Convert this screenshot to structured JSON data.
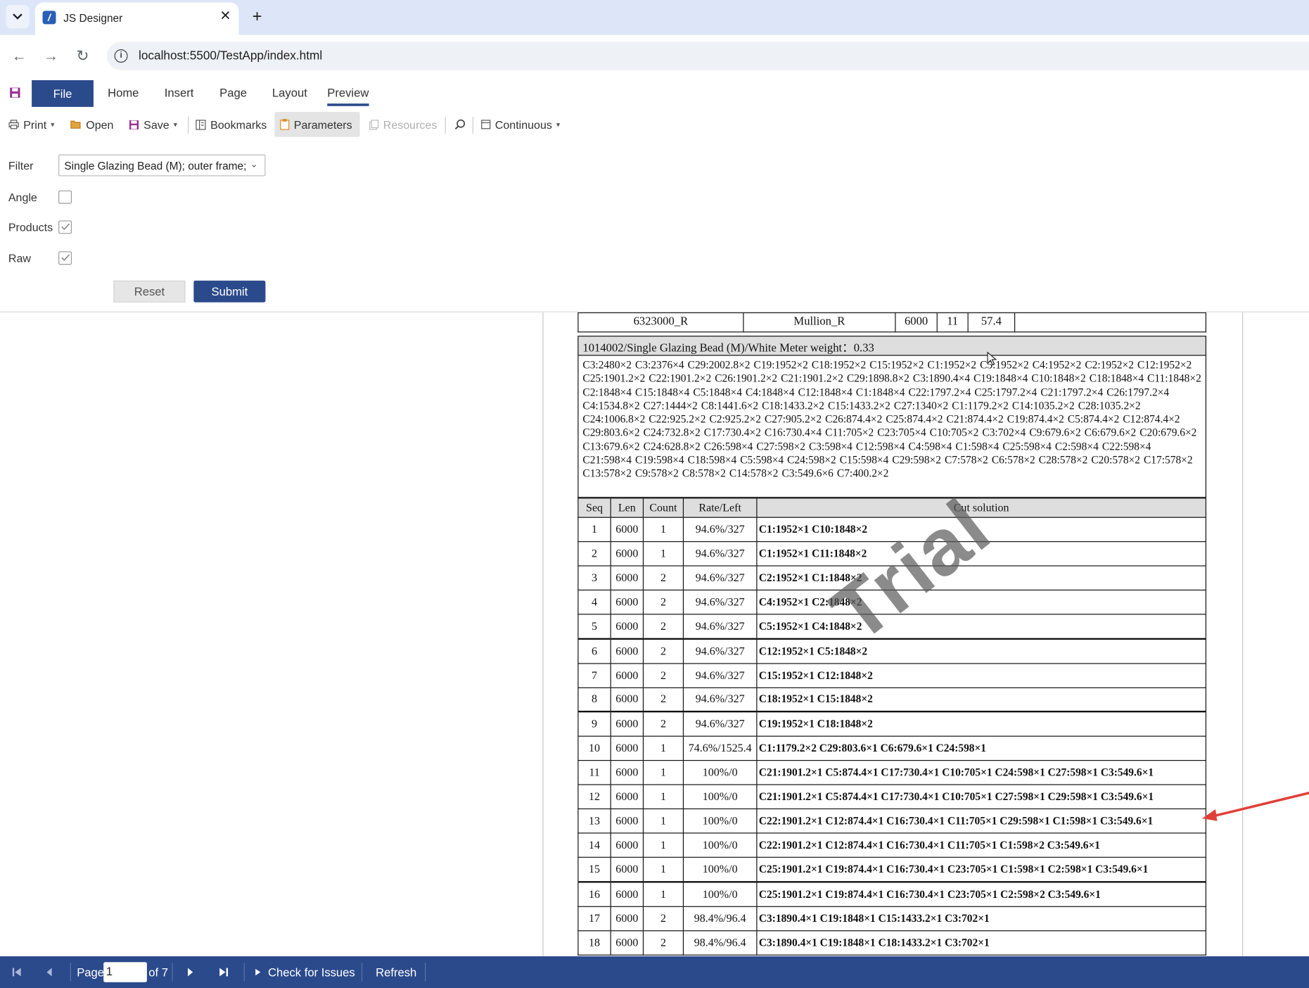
{
  "browser": {
    "tab_title": "JS Designer",
    "url": "localhost:5500/TestApp/index.html"
  },
  "ribbon": {
    "tabs": [
      "File",
      "Home",
      "Insert",
      "Page",
      "Layout",
      "Preview"
    ],
    "active_tab": "Preview"
  },
  "toolbar": {
    "print": "Print",
    "open": "Open",
    "save": "Save",
    "bookmarks": "Bookmarks",
    "parameters": "Parameters",
    "resources": "Resources",
    "continuous": "Continuous"
  },
  "parameters": {
    "filter_label": "Filter",
    "filter_value": "Single Glazing Bead (M); outer frame;",
    "angle_label": "Angle",
    "angle_checked": false,
    "products_label": "Products",
    "products_checked": true,
    "raw_label": "Raw",
    "raw_checked": true,
    "reset": "Reset",
    "submit": "Submit"
  },
  "report": {
    "top_row": [
      "6323000_R",
      "Mullion_R",
      "6000",
      "11",
      "57.4",
      ""
    ],
    "material_header": "1014002/Single Glazing Bead (M)/White Meter weight：0.33",
    "material_cuts": "C3:2480×2 C3:2376×4 C29:2002.8×2 C19:1952×2 C18:1952×2 C15:1952×2 C1:1952×2 C5:1952×2 C4:1952×2 C2:1952×2 C12:1952×2 C25:1901.2×2 C22:1901.2×2 C26:1901.2×2 C21:1901.2×2 C29:1898.8×2 C3:1890.4×4 C19:1848×4 C10:1848×2 C18:1848×4 C11:1848×2 C2:1848×4 C15:1848×4 C5:1848×4 C4:1848×4 C12:1848×4 C1:1848×4 C22:1797.2×4 C25:1797.2×4 C21:1797.2×4 C26:1797.2×4 C4:1534.8×2 C27:1444×2 C8:1441.6×2 C18:1433.2×2 C15:1433.2×2 C27:1340×2 C1:1179.2×2 C14:1035.2×2 C28:1035.2×2 C24:1006.8×2 C22:925.2×2 C2:925.2×2 C27:905.2×2 C26:874.4×2 C25:874.4×2 C21:874.4×2 C19:874.4×2 C5:874.4×2 C12:874.4×2 C29:803.6×2 C24:732.8×2 C17:730.4×2 C16:730.4×4 C11:705×2 C23:705×4 C10:705×2 C3:702×4 C9:679.6×2 C6:679.6×2 C20:679.6×2 C13:679.6×2 C24:628.8×2 C26:598×4 C27:598×2 C3:598×4 C12:598×4 C4:598×4 C1:598×4 C25:598×4 C2:598×4 C22:598×4 C21:598×4 C19:598×4 C18:598×4 C5:598×4 C24:598×2 C15:598×4 C29:598×2 C7:578×2 C6:578×2 C28:578×2 C20:578×2 C17:578×2 C13:578×2 C9:578×2 C8:578×2 C14:578×2 C3:549.6×6 C7:400.2×2",
    "columns": [
      "Seq",
      "Len",
      "Count",
      "Rate/Left",
      "Cut solution"
    ],
    "rows": [
      [
        "1",
        "6000",
        "1",
        "94.6%/327",
        "C1:1952×1  C10:1848×2"
      ],
      [
        "2",
        "6000",
        "1",
        "94.6%/327",
        "C1:1952×1  C11:1848×2"
      ],
      [
        "3",
        "6000",
        "2",
        "94.6%/327",
        "C2:1952×1  C1:1848×2"
      ],
      [
        "4",
        "6000",
        "2",
        "94.6%/327",
        "C4:1952×1  C2:1848×2"
      ],
      [
        "5",
        "6000",
        "2",
        "94.6%/327",
        "C5:1952×1  C4:1848×2"
      ],
      [
        "6",
        "6000",
        "2",
        "94.6%/327",
        "C12:1952×1  C5:1848×2"
      ],
      [
        "7",
        "6000",
        "2",
        "94.6%/327",
        "C15:1952×1  C12:1848×2"
      ],
      [
        "8",
        "6000",
        "2",
        "94.6%/327",
        "C18:1952×1  C15:1848×2"
      ],
      [
        "9",
        "6000",
        "2",
        "94.6%/327",
        "C19:1952×1  C18:1848×2"
      ],
      [
        "10",
        "6000",
        "1",
        "74.6%/1525.4",
        "C1:1179.2×2  C29:803.6×1  C6:679.6×1  C24:598×1"
      ],
      [
        "11",
        "6000",
        "1",
        "100%/0",
        "C21:1901.2×1  C5:874.4×1  C17:730.4×1  C10:705×1  C24:598×1  C27:598×1  C3:549.6×1"
      ],
      [
        "12",
        "6000",
        "1",
        "100%/0",
        "C21:1901.2×1  C5:874.4×1  C17:730.4×1  C10:705×1  C27:598×1  C29:598×1  C3:549.6×1"
      ],
      [
        "13",
        "6000",
        "1",
        "100%/0",
        "C22:1901.2×1  C12:874.4×1  C16:730.4×1  C11:705×1  C29:598×1  C1:598×1  C3:549.6×1"
      ],
      [
        "14",
        "6000",
        "1",
        "100%/0",
        "C22:1901.2×1  C12:874.4×1  C16:730.4×1  C11:705×1  C1:598×2  C3:549.6×1"
      ],
      [
        "15",
        "6000",
        "1",
        "100%/0",
        "C25:1901.2×1  C19:874.4×1  C16:730.4×1  C23:705×1  C1:598×1  C2:598×1  C3:549.6×1"
      ],
      [
        "16",
        "6000",
        "1",
        "100%/0",
        "C25:1901.2×1  C19:874.4×1  C16:730.4×1  C23:705×1  C2:598×2  C3:549.6×1"
      ],
      [
        "17",
        "6000",
        "2",
        "98.4%/96.4",
        "C3:1890.4×1  C19:1848×1  C15:1433.2×1  C3:702×1"
      ],
      [
        "18",
        "6000",
        "2",
        "98.4%/96.4",
        "C3:1890.4×1  C19:1848×1  C18:1433.2×1  C3:702×1"
      ]
    ],
    "watermark": "Trial"
  },
  "bottom_bar": {
    "page_label": "Page",
    "page_value": "1",
    "of_total": "of 7",
    "check_issues": "Check for Issues",
    "refresh": "Refresh"
  },
  "colors": {
    "brand": "#2b4a8c",
    "arrow": "#e0403a",
    "table_header_bg": "#dedede"
  }
}
